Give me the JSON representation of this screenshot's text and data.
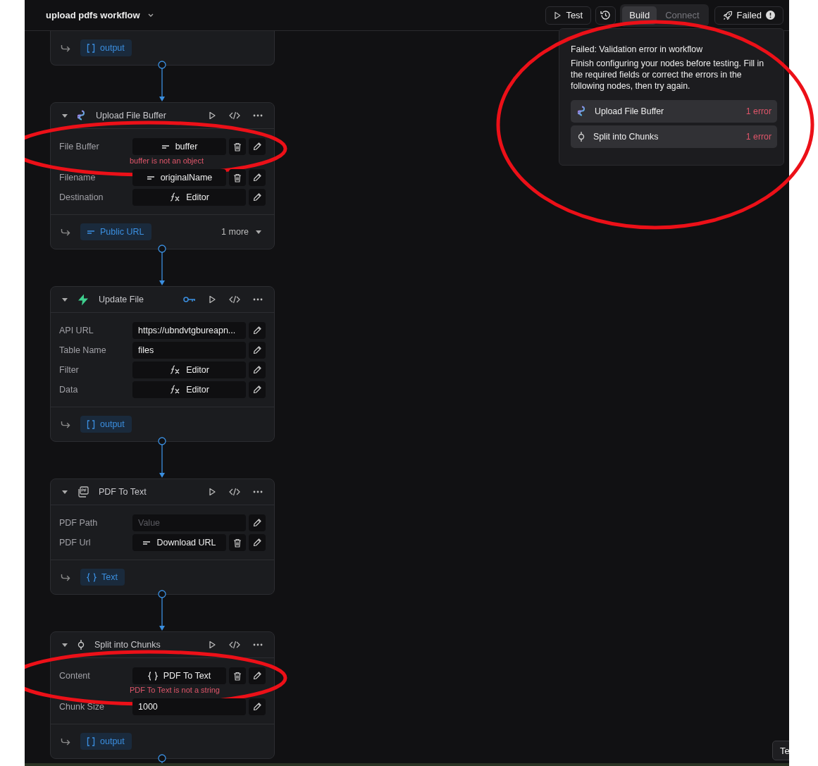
{
  "topbar": {
    "title": "upload pdfs workflow",
    "test_label": "Test",
    "modes": [
      {
        "label": "Build",
        "selected": true
      },
      {
        "label": "Connect",
        "selected": false
      }
    ],
    "status": "Failed"
  },
  "nodes": [
    {
      "output": {
        "kind": "array",
        "label": "output"
      }
    },
    {
      "title": "Upload File Buffer",
      "kind": "swirl",
      "auth": false,
      "fields": [
        {
          "label": "File Buffer",
          "kind": "ref",
          "value": "buffer",
          "deletable": true,
          "error": "buffer is not an object",
          "circled": true
        },
        {
          "label": "Filename",
          "kind": "ref",
          "value": "originalName",
          "deletable": true,
          "circled": false
        },
        {
          "label": "Destination",
          "kind": "editor",
          "value": "Editor",
          "deletable": false,
          "circled": false
        }
      ],
      "output": {
        "kind": "string",
        "label": "Public URL"
      },
      "more": "1 more"
    },
    {
      "title": "Update File",
      "kind": "bolt",
      "auth": true,
      "fields": [
        {
          "label": "API URL",
          "kind": "text",
          "value": "https://ubndvtgbureapn...",
          "deletable": false,
          "circled": false
        },
        {
          "label": "Table Name",
          "kind": "text",
          "value": "files",
          "deletable": false,
          "circled": false
        },
        {
          "label": "Filter",
          "kind": "editor",
          "value": "Editor",
          "deletable": false,
          "circled": false
        },
        {
          "label": "Data",
          "kind": "editor",
          "value": "Editor",
          "deletable": false,
          "circled": false
        }
      ],
      "output": {
        "kind": "array",
        "label": "output"
      }
    },
    {
      "title": "PDF To Text",
      "kind": "pdf",
      "auth": false,
      "fields": [
        {
          "label": "PDF Path",
          "kind": "empty",
          "placeholder": "Value",
          "deletable": false,
          "circled": false
        },
        {
          "label": "PDF Url",
          "kind": "ref",
          "value": "Download URL",
          "deletable": true,
          "circled": false
        }
      ],
      "output": {
        "kind": "object",
        "label": "Text"
      }
    },
    {
      "title": "Split into Chunks",
      "kind": "split",
      "auth": false,
      "fields": [
        {
          "label": "Content",
          "kind": "object",
          "value": "PDF To Text",
          "deletable": true,
          "error": "PDF To Text is not a string",
          "circled": true
        },
        {
          "label": "Chunk Size",
          "kind": "text",
          "value": "1000",
          "deletable": false,
          "circled": false
        }
      ],
      "output": {
        "kind": "array",
        "label": "output"
      }
    }
  ],
  "popup": {
    "title": "Failed: Validation error in workflow",
    "message": "Finish configuring your nodes before testing. Fill in the required fields or correct the errors in the following nodes, then try again.",
    "circled": true,
    "items": [
      {
        "name": "Upload File Buffer",
        "kind": "swirl",
        "count": "1 error"
      },
      {
        "name": "Split into Chunks",
        "kind": "split",
        "count": "1 error"
      }
    ]
  },
  "corner_button": "Te"
}
